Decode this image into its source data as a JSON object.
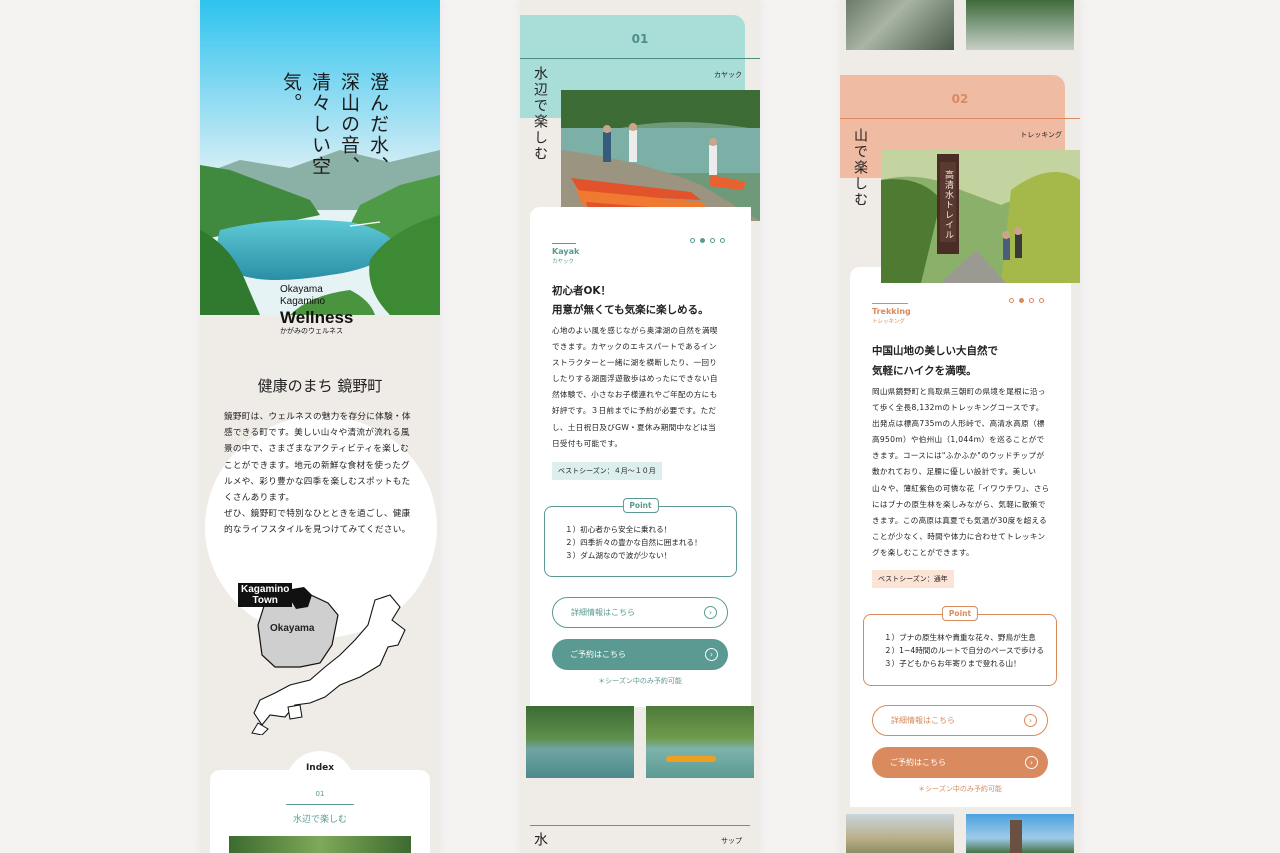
{
  "panel1": {
    "hero_copy": [
      "澄んだ水、",
      "深山の音、",
      "清々しい空気。"
    ],
    "logo": {
      "line1": "Okayama",
      "line2": "Kagamino",
      "line3": "Wellness",
      "line4": "かがみのウェルネス"
    },
    "heading": "健康のまち 鏡野町",
    "paragraph_1": "鏡野町は、ウェルネスの魅力を存分に体験・体感できる町です。美しい山々や清流が流れる風景の中で、さまざまなアクティビティを楽しむことができます。地元の新鮮な食材を使ったグルメや、彩り豊かな四季を楽しむスポットもたくさんあります。",
    "paragraph_2": "ぜひ、鏡野町で特別なひとときを過ごし、健康的なライフスタイルを見つけてみてください。",
    "map": {
      "town_label_1": "Kagamino",
      "town_label_2": "Town",
      "pref_label": "Okayama"
    },
    "index": {
      "title": "Index",
      "num": "01",
      "item": "水辺で楽しむ"
    }
  },
  "panel2": {
    "num": "01",
    "category": "カヤック",
    "vertical": "水辺で楽しむ",
    "tag_en": "Kayak",
    "tag_jp": "カヤック",
    "headline_1": "初心者OK！",
    "headline_2": "用意が無くても気楽に楽しめる。",
    "body": "心地のよい風を感じながら奥津湖の自然を満喫できます。カヤックのエキスパートであるインストラクターと一緒に湖を横断したり、一回りしたりする湖面浮遊散歩はめったにできない自然体験で、小さなお子様連れやご年配の方にも好評です。３日前までに予約が必要です。ただし、土日祝日及びGW・夏休み期間中などは当日受付も可能です。",
    "season": "ベストシーズン：４月〜１０月",
    "point_label": "Point",
    "points": [
      "１）初心者から安全に乗れる！",
      "２）四季折々の豊かな自然に囲まれる！",
      "３）ダム湖なので波が少ない！"
    ],
    "detail_btn": "詳細情報はこちら",
    "reserve_btn": "ご予約はこちら",
    "note": "＊シーズン中のみ予約可能",
    "next_vertical": "水",
    "next_category": "サップ",
    "accent": "#5a9a92",
    "header_bg": "#a8ddd8"
  },
  "panel3": {
    "num": "02",
    "category": "トレッキング",
    "vertical": "山で楽しむ",
    "sign_text": "高清水トレイル",
    "tag_en": "Trekking",
    "tag_jp": "トレッキング",
    "headline_1": "中国山地の美しい大自然で",
    "headline_2": "気軽にハイクを満喫。",
    "body": "岡山県鏡野町と鳥取県三朝町の県境を尾根に沿って歩く全長8,132mのトレッキングコースです。出発点は標高735mの人形峠で、高清水高原（標高950m）や伯州山（1,044m）を巡ることができます。コースには\"ふかふか\"のウッドチップが敷かれており、足腰に優しい設計です。美しい山々や、薄紅紫色の可憐な花「イワウチワ」、さらにはブナの原生林を楽しみながら、気軽に散策できます。この高原は真夏でも気温が30度を超えることが少なく、時間や体力に合わせてトレッキングを楽しむことができます。",
    "season": "ベストシーズン：通年",
    "point_label": "Point",
    "points": [
      "１）ブナの原生林や貴重な花々、野鳥が生息",
      "２）1~4時間のルートで自分のペースで歩ける",
      "３）子どもからお年寄りまで登れる山！"
    ],
    "detail_btn": "詳細情報はこちら",
    "reserve_btn": "ご予約はこちら",
    "note": "＊シーズン中のみ予約可能",
    "accent": "#d98a5e",
    "header_bg": "#f0bba3"
  }
}
